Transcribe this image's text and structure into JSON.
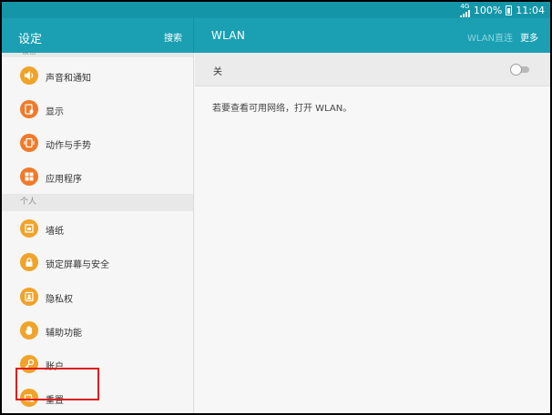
{
  "status_bar": {
    "network": "4G",
    "battery_percent": "100%",
    "time": "11:04"
  },
  "left_pane": {
    "title": "设定",
    "search_label": "搜索",
    "cut_section_label": "设备",
    "items_device": [
      {
        "label": "声音和通知",
        "icon": "volume-icon"
      },
      {
        "label": "显示",
        "icon": "display-icon"
      },
      {
        "label": "动作与手势",
        "icon": "motion-gesture-icon"
      },
      {
        "label": "应用程序",
        "icon": "apps-grid-icon"
      }
    ],
    "section_personal": "个人",
    "items_personal": [
      {
        "label": "墙纸",
        "icon": "wallpaper-icon"
      },
      {
        "label": "锁定屏幕与安全",
        "icon": "lock-icon"
      },
      {
        "label": "隐私权",
        "icon": "privacy-icon"
      },
      {
        "label": "辅助功能",
        "icon": "hand-icon",
        "highlighted": true
      },
      {
        "label": "账户",
        "icon": "key-icon"
      },
      {
        "label": "重置",
        "icon": "reset-icon"
      }
    ]
  },
  "right_pane": {
    "title": "WLAN",
    "wlan_direct_label": "WLAN直连",
    "more_label": "更多",
    "toggle_label": "关",
    "toggle_on": false,
    "hint_text": "若要查看可用网络，打开 WLAN。"
  },
  "colors": {
    "header_bg": "#1ba0b3",
    "status_bg": "#1596a8",
    "icon_orange": "#f0a32a",
    "highlight_red": "#e21b1b"
  }
}
